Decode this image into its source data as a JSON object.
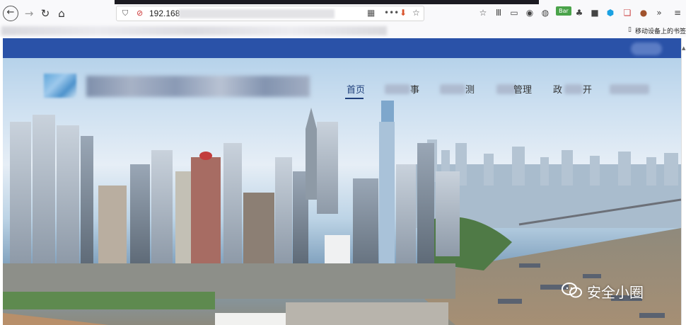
{
  "browser": {
    "url_text": "192.168",
    "mobile_bookmarks_label": "移动设备上的书签",
    "extension_badge": "Bar",
    "colors": {
      "chrome": "#f9f9fb",
      "tab_strip": "#1c1b22"
    },
    "icons": [
      "back-icon",
      "forward-icon",
      "reload-icon",
      "home-icon",
      "shield-icon",
      "insecure-lock-icon",
      "qr-icon",
      "more-icon",
      "pocket-icon",
      "star-icon",
      "library-icon",
      "sidebar-icon",
      "account-icon",
      "chat-icon",
      "extensions-icon",
      "overflow-icon",
      "menu-icon"
    ]
  },
  "site": {
    "colors": {
      "header_strip": "#2a52a8",
      "nav_active": "#1f3f7a"
    },
    "nav": {
      "home": "首页",
      "item2_visible": "事",
      "item3_visible": "测",
      "item4_visible": "管理",
      "item5_visible": "政",
      "item5_tail": "开"
    }
  },
  "watermark": {
    "text": "安全小圈"
  }
}
